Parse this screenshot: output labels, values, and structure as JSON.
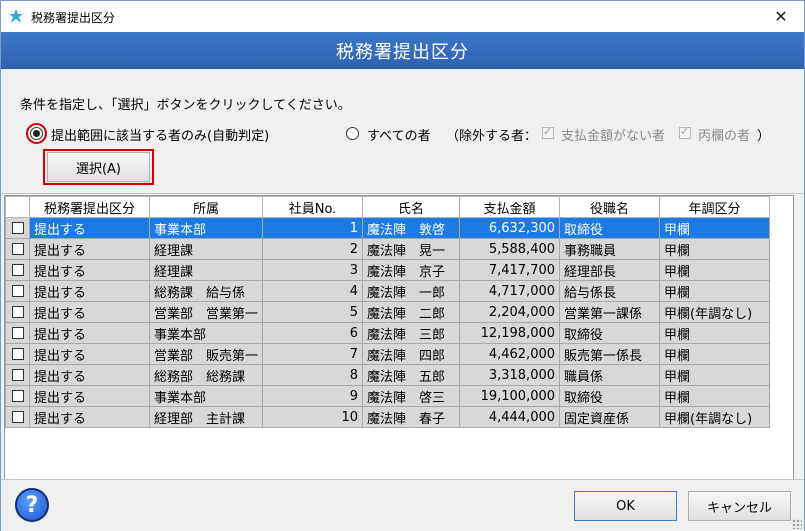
{
  "window": {
    "title": "税務署提出区分",
    "close_glyph": "✕",
    "header": "税務署提出区分"
  },
  "conditions": {
    "instruction": "条件を指定し、「選択」ボタンをクリックしてください。",
    "option_auto": "提出範囲に該当する者のみ(自動判定)",
    "option_all": "すべての者",
    "exclude_label": "（除外する者：",
    "exclude_no_payment": "支払金額がない者",
    "exclude_hei": "丙欄の者",
    "exclude_close": "）",
    "select_button": "選択(A)"
  },
  "grid": {
    "columns": [
      "",
      "税務署提出区分",
      "所属",
      "社員No.",
      "氏名",
      "支払金額",
      "役職名",
      "年調区分"
    ],
    "rows": [
      {
        "status": "提出する",
        "dept": "事業本部",
        "no": "1",
        "name": "魔法陣　敦啓",
        "amount": "6,632,300",
        "position": "取締役",
        "nencho": "甲欄"
      },
      {
        "status": "提出する",
        "dept": "経理課",
        "no": "2",
        "name": "魔法陣　晃一",
        "amount": "5,588,400",
        "position": "事務職員",
        "nencho": "甲欄"
      },
      {
        "status": "提出する",
        "dept": "経理課",
        "no": "3",
        "name": "魔法陣　京子",
        "amount": "7,417,700",
        "position": "経理部長",
        "nencho": "甲欄"
      },
      {
        "status": "提出する",
        "dept": "総務課　給与係",
        "no": "4",
        "name": "魔法陣　一郎",
        "amount": "4,717,000",
        "position": "給与係長",
        "nencho": "甲欄"
      },
      {
        "status": "提出する",
        "dept": "営業部　営業第一",
        "no": "5",
        "name": "魔法陣　二郎",
        "amount": "2,204,000",
        "position": "営業第一課係",
        "nencho": "甲欄(年調なし)"
      },
      {
        "status": "提出する",
        "dept": "事業本部",
        "no": "6",
        "name": "魔法陣　三郎",
        "amount": "12,198,000",
        "position": "取締役",
        "nencho": "甲欄"
      },
      {
        "status": "提出する",
        "dept": "営業部　販売第一",
        "no": "7",
        "name": "魔法陣　四郎",
        "amount": "4,462,000",
        "position": "販売第一係長",
        "nencho": "甲欄"
      },
      {
        "status": "提出する",
        "dept": "総務部　総務課",
        "no": "8",
        "name": "魔法陣　五郎",
        "amount": "3,318,000",
        "position": "職員係",
        "nencho": "甲欄"
      },
      {
        "status": "提出する",
        "dept": "事業本部",
        "no": "9",
        "name": "魔法陣　啓三",
        "amount": "19,100,000",
        "position": "取締役",
        "nencho": "甲欄"
      },
      {
        "status": "提出する",
        "dept": "経理部　主計課",
        "no": "10",
        "name": "魔法陣　春子",
        "amount": "4,444,000",
        "position": "固定資産係",
        "nencho": "甲欄(年調なし)"
      }
    ]
  },
  "footer": {
    "help_glyph": "?",
    "ok_button": "OK",
    "cancel_button": "キャンセル"
  },
  "colors": {
    "header_band": "#3a70c0",
    "selected_row": "#1b7be3",
    "highlight_frame": "#d40000"
  }
}
